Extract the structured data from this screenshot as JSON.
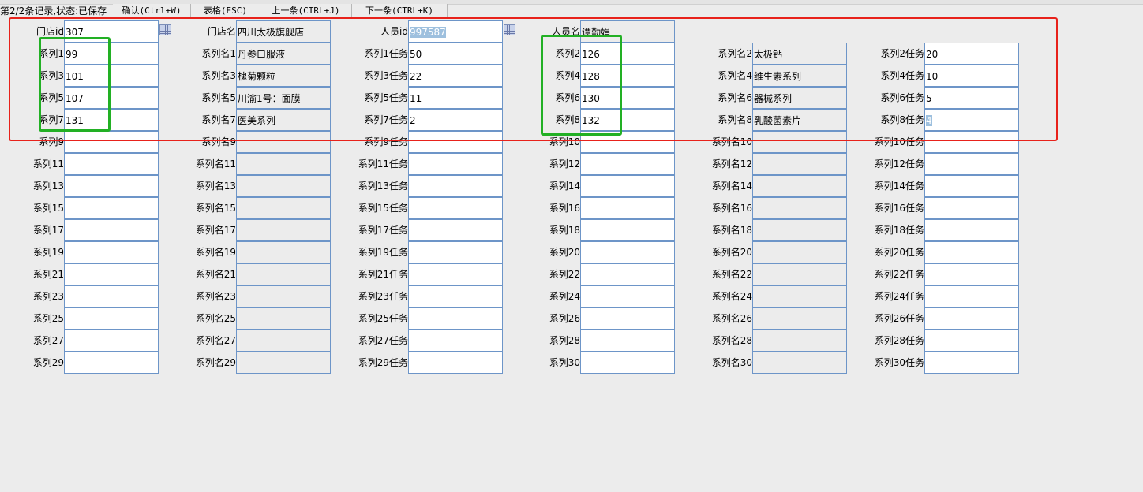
{
  "toolbar": {
    "status": "第2/2条记录,状态:已保存",
    "confirm_label": "确认(Ctrl+W)",
    "table_label": "表格(ESC)",
    "prev_label": "上一条(CTRL+J)",
    "next_label": "下一条(CTRL+K)"
  },
  "header": {
    "store_id_label": "门店id",
    "store_id_value": "307",
    "store_name_label": "门店名",
    "store_name_value": "四川太极旗舰店",
    "staff_id_label": "人员id",
    "staff_id_value": "997587",
    "staff_name_label": "人员名",
    "staff_name_value": "谭勤娟"
  },
  "series": [
    {
      "code_label": "系列1",
      "code": "99",
      "name_label": "系列名1",
      "name": "丹参口服液",
      "task_label": "系列1任务",
      "task": "50"
    },
    {
      "code_label": "系列2",
      "code": "126",
      "name_label": "系列名2",
      "name": "太极钙",
      "task_label": "系列2任务",
      "task": "20"
    },
    {
      "code_label": "系列3",
      "code": "101",
      "name_label": "系列名3",
      "name": "槐菊颗粒",
      "task_label": "系列3任务",
      "task": "22"
    },
    {
      "code_label": "系列4",
      "code": "128",
      "name_label": "系列名4",
      "name": "维生素系列",
      "task_label": "系列4任务",
      "task": "10"
    },
    {
      "code_label": "系列5",
      "code": "107",
      "name_label": "系列名5",
      "name": "川渝1号：面膜",
      "task_label": "系列5任务",
      "task": "11"
    },
    {
      "code_label": "系列6",
      "code": "130",
      "name_label": "系列名6",
      "name": "器械系列",
      "task_label": "系列6任务",
      "task": "5"
    },
    {
      "code_label": "系列7",
      "code": "131",
      "name_label": "系列名7",
      "name": "医美系列",
      "task_label": "系列7任务",
      "task": "2"
    },
    {
      "code_label": "系列8",
      "code": "132",
      "name_label": "系列名8",
      "name": "乳酸菌素片",
      "task_label": "系列8任务",
      "task": "4"
    },
    {
      "code_label": "系列9",
      "code": "",
      "name_label": "系列名9",
      "name": "",
      "task_label": "系列9任务",
      "task": ""
    },
    {
      "code_label": "系列10",
      "code": "",
      "name_label": "系列名10",
      "name": "",
      "task_label": "系列10任务",
      "task": ""
    },
    {
      "code_label": "系列11",
      "code": "",
      "name_label": "系列名11",
      "name": "",
      "task_label": "系列11任务",
      "task": ""
    },
    {
      "code_label": "系列12",
      "code": "",
      "name_label": "系列名12",
      "name": "",
      "task_label": "系列12任务",
      "task": ""
    },
    {
      "code_label": "系列13",
      "code": "",
      "name_label": "系列名13",
      "name": "",
      "task_label": "系列13任务",
      "task": ""
    },
    {
      "code_label": "系列14",
      "code": "",
      "name_label": "系列名14",
      "name": "",
      "task_label": "系列14任务",
      "task": ""
    },
    {
      "code_label": "系列15",
      "code": "",
      "name_label": "系列名15",
      "name": "",
      "task_label": "系列15任务",
      "task": ""
    },
    {
      "code_label": "系列16",
      "code": "",
      "name_label": "系列名16",
      "name": "",
      "task_label": "系列16任务",
      "task": ""
    },
    {
      "code_label": "系列17",
      "code": "",
      "name_label": "系列名17",
      "name": "",
      "task_label": "系列17任务",
      "task": ""
    },
    {
      "code_label": "系列18",
      "code": "",
      "name_label": "系列名18",
      "name": "",
      "task_label": "系列18任务",
      "task": ""
    },
    {
      "code_label": "系列19",
      "code": "",
      "name_label": "系列名19",
      "name": "",
      "task_label": "系列19任务",
      "task": ""
    },
    {
      "code_label": "系列20",
      "code": "",
      "name_label": "系列名20",
      "name": "",
      "task_label": "系列20任务",
      "task": ""
    },
    {
      "code_label": "系列21",
      "code": "",
      "name_label": "系列名21",
      "name": "",
      "task_label": "系列21任务",
      "task": ""
    },
    {
      "code_label": "系列22",
      "code": "",
      "name_label": "系列名22",
      "name": "",
      "task_label": "系列22任务",
      "task": ""
    },
    {
      "code_label": "系列23",
      "code": "",
      "name_label": "系列名23",
      "name": "",
      "task_label": "系列23任务",
      "task": ""
    },
    {
      "code_label": "系列24",
      "code": "",
      "name_label": "系列名24",
      "name": "",
      "task_label": "系列24任务",
      "task": ""
    },
    {
      "code_label": "系列25",
      "code": "",
      "name_label": "系列名25",
      "name": "",
      "task_label": "系列25任务",
      "task": ""
    },
    {
      "code_label": "系列26",
      "code": "",
      "name_label": "系列名26",
      "name": "",
      "task_label": "系列26任务",
      "task": ""
    },
    {
      "code_label": "系列27",
      "code": "",
      "name_label": "系列名27",
      "name": "",
      "task_label": "系列27任务",
      "task": ""
    },
    {
      "code_label": "系列28",
      "code": "",
      "name_label": "系列名28",
      "name": "",
      "task_label": "系列28任务",
      "task": ""
    },
    {
      "code_label": "系列29",
      "code": "",
      "name_label": "系列名29",
      "name": "",
      "task_label": "系列29任务",
      "task": ""
    },
    {
      "code_label": "系列30",
      "code": "",
      "name_label": "系列名30",
      "name": "",
      "task_label": "系列30任务",
      "task": ""
    }
  ]
}
